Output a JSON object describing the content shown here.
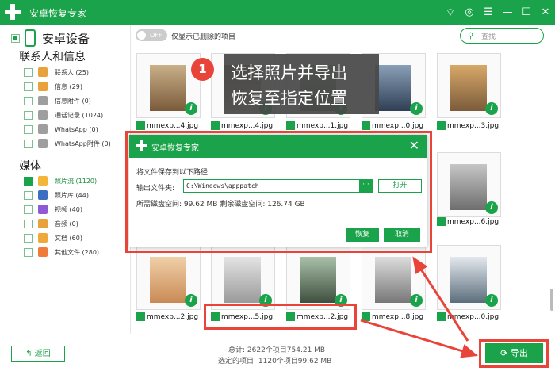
{
  "app_title": "安卓恢复专家",
  "device_name": "安卓设备",
  "sections": {
    "contacts": "联系人和信息",
    "media": "媒体"
  },
  "contacts_items": [
    {
      "label": "联系人 (25)",
      "icon": "contacts-icon",
      "color": "#e9a23b"
    },
    {
      "label": "信息 (29)",
      "icon": "message-icon",
      "color": "#e9a23b"
    },
    {
      "label": "信息附件 (0)",
      "icon": "attachment-icon",
      "color": "#9e9e9e"
    },
    {
      "label": "通话记录 (1024)",
      "icon": "call-log-icon",
      "color": "#9e9e9e"
    },
    {
      "label": "WhatsApp (0)",
      "icon": "whatsapp-icon",
      "color": "#9e9e9e"
    },
    {
      "label": "WhatsApp附件 (0)",
      "icon": "whatsapp-attachment-icon",
      "color": "#9e9e9e"
    }
  ],
  "media_items": [
    {
      "label": "照片流 (1120)",
      "icon": "photo-stream-icon",
      "color": "#f2b63b"
    },
    {
      "label": "照片库 (44)",
      "icon": "photo-library-icon",
      "color": "#3b6fc2"
    },
    {
      "label": "视频 (40)",
      "icon": "video-icon",
      "color": "#8f5ad6"
    },
    {
      "label": "音频 (0)",
      "icon": "audio-icon",
      "color": "#e9a23b"
    },
    {
      "label": "文档 (60)",
      "icon": "document-icon",
      "color": "#f0a83a"
    },
    {
      "label": "其他文件 (280)",
      "icon": "other-files-icon",
      "color": "#f07a3a"
    }
  ],
  "toggle_label": "OFF",
  "toggle_text": "仅显示已删除的项目",
  "search_placeholder": "查找",
  "files_row1": [
    "mmexp...4.jpg",
    "mmexp...4.jpg",
    "mmexp...1.jpg",
    "mmexp...0.jpg",
    "mmexp...3.jpg"
  ],
  "files_right_mid": "mmexp...6.jpg",
  "files_row3": [
    "mmexp...2.jpg",
    "mmexp...5.jpg",
    "mmexp...2.jpg",
    "mmexp...8.jpg",
    "mmexp...0.jpg"
  ],
  "callout": {
    "number": "1",
    "line1": "选择照片并导出",
    "line2": "恢复至指定位置"
  },
  "dialog": {
    "title": "安卓恢复专家",
    "save_prompt": "将文件保存到以下路径",
    "output_label": "输出文件夹:",
    "path": "C:\\Windows\\apppatch",
    "browse": "···",
    "open": "打开",
    "space_info": "所需磁盘空间:  99.62 MB  剩余磁盘空间:   126.74 GB",
    "restore": "恢复",
    "cancel": "取消"
  },
  "bottom": {
    "back": "返回",
    "total": "总计: 2622个项目754.21 MB",
    "selected": "选定的项目: 1120个项目99.62 MB",
    "export": "导出"
  },
  "colors": {
    "brand": "#1aa34a",
    "highlight": "#e8443a"
  }
}
